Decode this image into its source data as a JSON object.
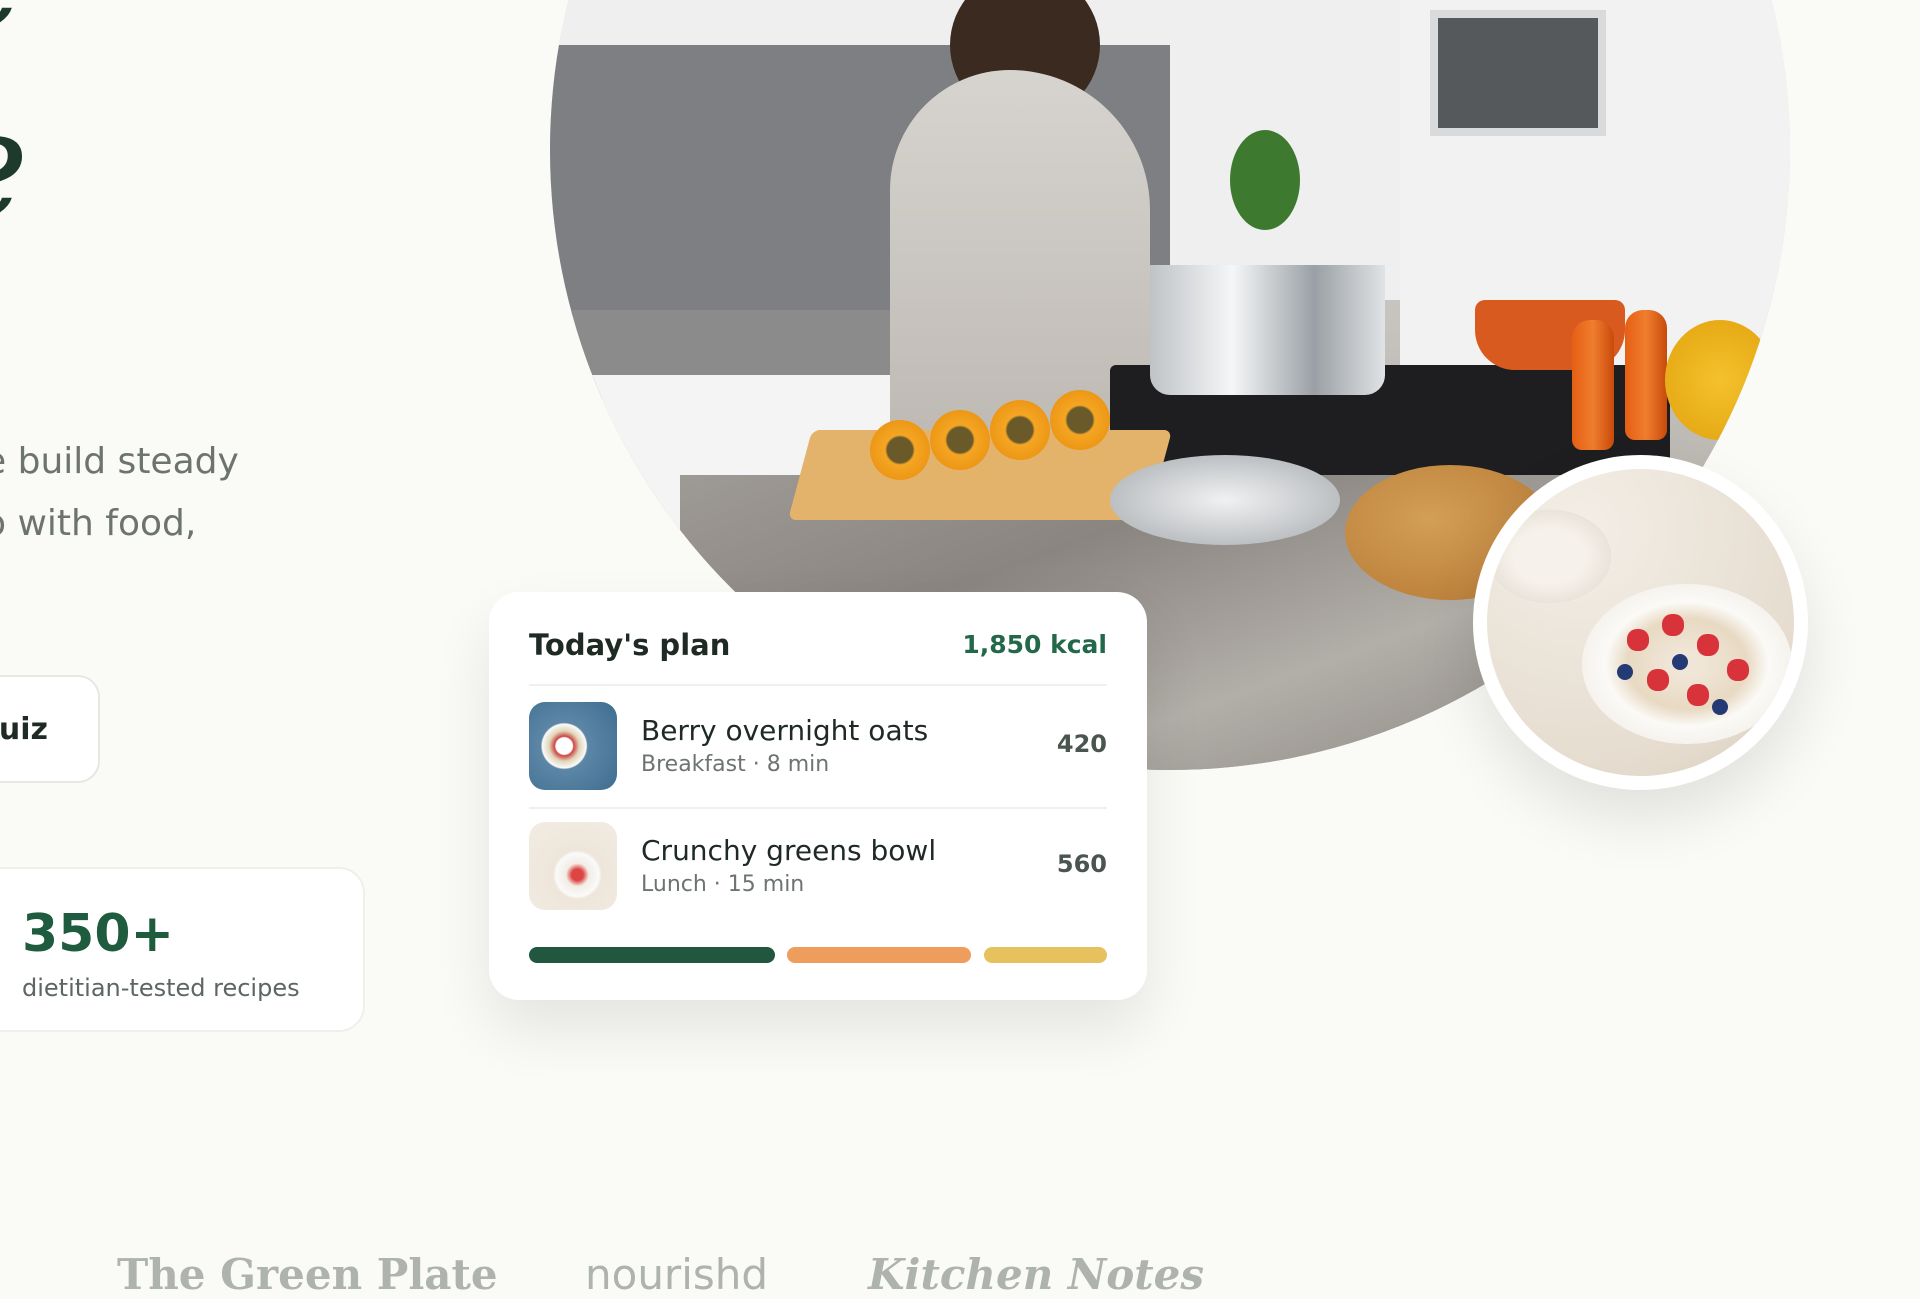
{
  "hero": {
    "headline_line1": "e",
    "headline_line2": "e",
    "subtitle_line1": "e build steady",
    "subtitle_line2": "o with food,",
    "quiz_button_label": "quiz"
  },
  "stat": {
    "value": "350+",
    "label": "dietitian-tested recipes"
  },
  "plan": {
    "title": "Today's plan",
    "total_kcal": "1,850 kcal",
    "meals": [
      {
        "name": "Berry overnight oats",
        "meta": "Breakfast · 8 min",
        "kcal": "420"
      },
      {
        "name": "Crunchy greens bowl",
        "meta": "Lunch · 15 min",
        "kcal": "560"
      }
    ],
    "macro_bar_colors": [
      "#22573f",
      "#ef9d5d",
      "#e6c15d"
    ]
  },
  "press": {
    "logos": [
      "The Green Plate",
      "nourishd",
      "Kitchen Notes"
    ]
  },
  "colors": {
    "background": "#fafaf7",
    "accent_green": "#24684a",
    "text_dark": "#1f2a24",
    "text_muted": "#6d7470"
  }
}
